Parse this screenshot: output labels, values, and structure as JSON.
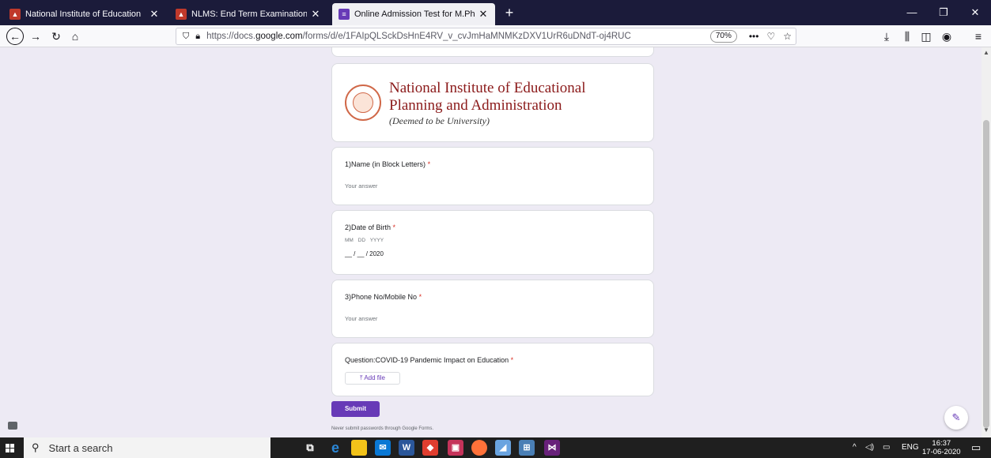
{
  "browser": {
    "tabs": [
      {
        "title": "National Institute of Education",
        "favicon": "niepa-logo-icon",
        "active": false
      },
      {
        "title": "NLMS: End Term Examinations",
        "favicon": "niepa-logo-icon",
        "active": false
      },
      {
        "title": "Online Admission Test for M.Ph",
        "favicon": "google-forms-icon",
        "active": true
      }
    ],
    "new_tab_glyph": "+",
    "window_controls": {
      "minimize": "—",
      "maximize": "❐",
      "close": "✕"
    },
    "url_prefix": "https://docs.",
    "url_domain": "google.com",
    "url_suffix": "/forms/d/e/1FAIpQLSckDsHnE4RV_v_cvJmHaMNMKzDXV1UrR6uDNdT-oj4RUC",
    "zoom": "70%"
  },
  "form": {
    "header": {
      "line1": "National Institute of Educational",
      "line2": "Planning and Administration",
      "line3": "(Deemed to be University)"
    },
    "required_mark": "*",
    "questions": [
      {
        "title": "1)Name (in Block Letters)",
        "placeholder": "Your answer"
      },
      {
        "title": "2)Date of Birth",
        "date_labels": "MM DD YYYY",
        "date_value": "__ / __ / 2020"
      },
      {
        "title": "3)Phone No/Mobile No",
        "placeholder": "Your answer"
      },
      {
        "title": "Question:COVID-19 Pandemic Impact on Education",
        "add_file_label": "Add file"
      }
    ],
    "submit_label": "Submit",
    "never_submit_note": "Never submit passwords through Google Forms."
  },
  "taskbar": {
    "search_placeholder": "Start a search",
    "apps": [
      "task-view",
      "edge",
      "file-explorer",
      "mail",
      "word",
      "app-red",
      "app-pink",
      "firefox",
      "app-blue",
      "app-network",
      "visual-studio"
    ],
    "tray_language": "ENG",
    "time": "16:37",
    "date": "17-06-2020"
  },
  "colors": {
    "forms_accent": "#673ab7",
    "page_bg": "#edeaf4",
    "tabstrip_bg": "#1b1b3a",
    "required": "#d93025",
    "niepa_red": "#8b1a1a"
  }
}
